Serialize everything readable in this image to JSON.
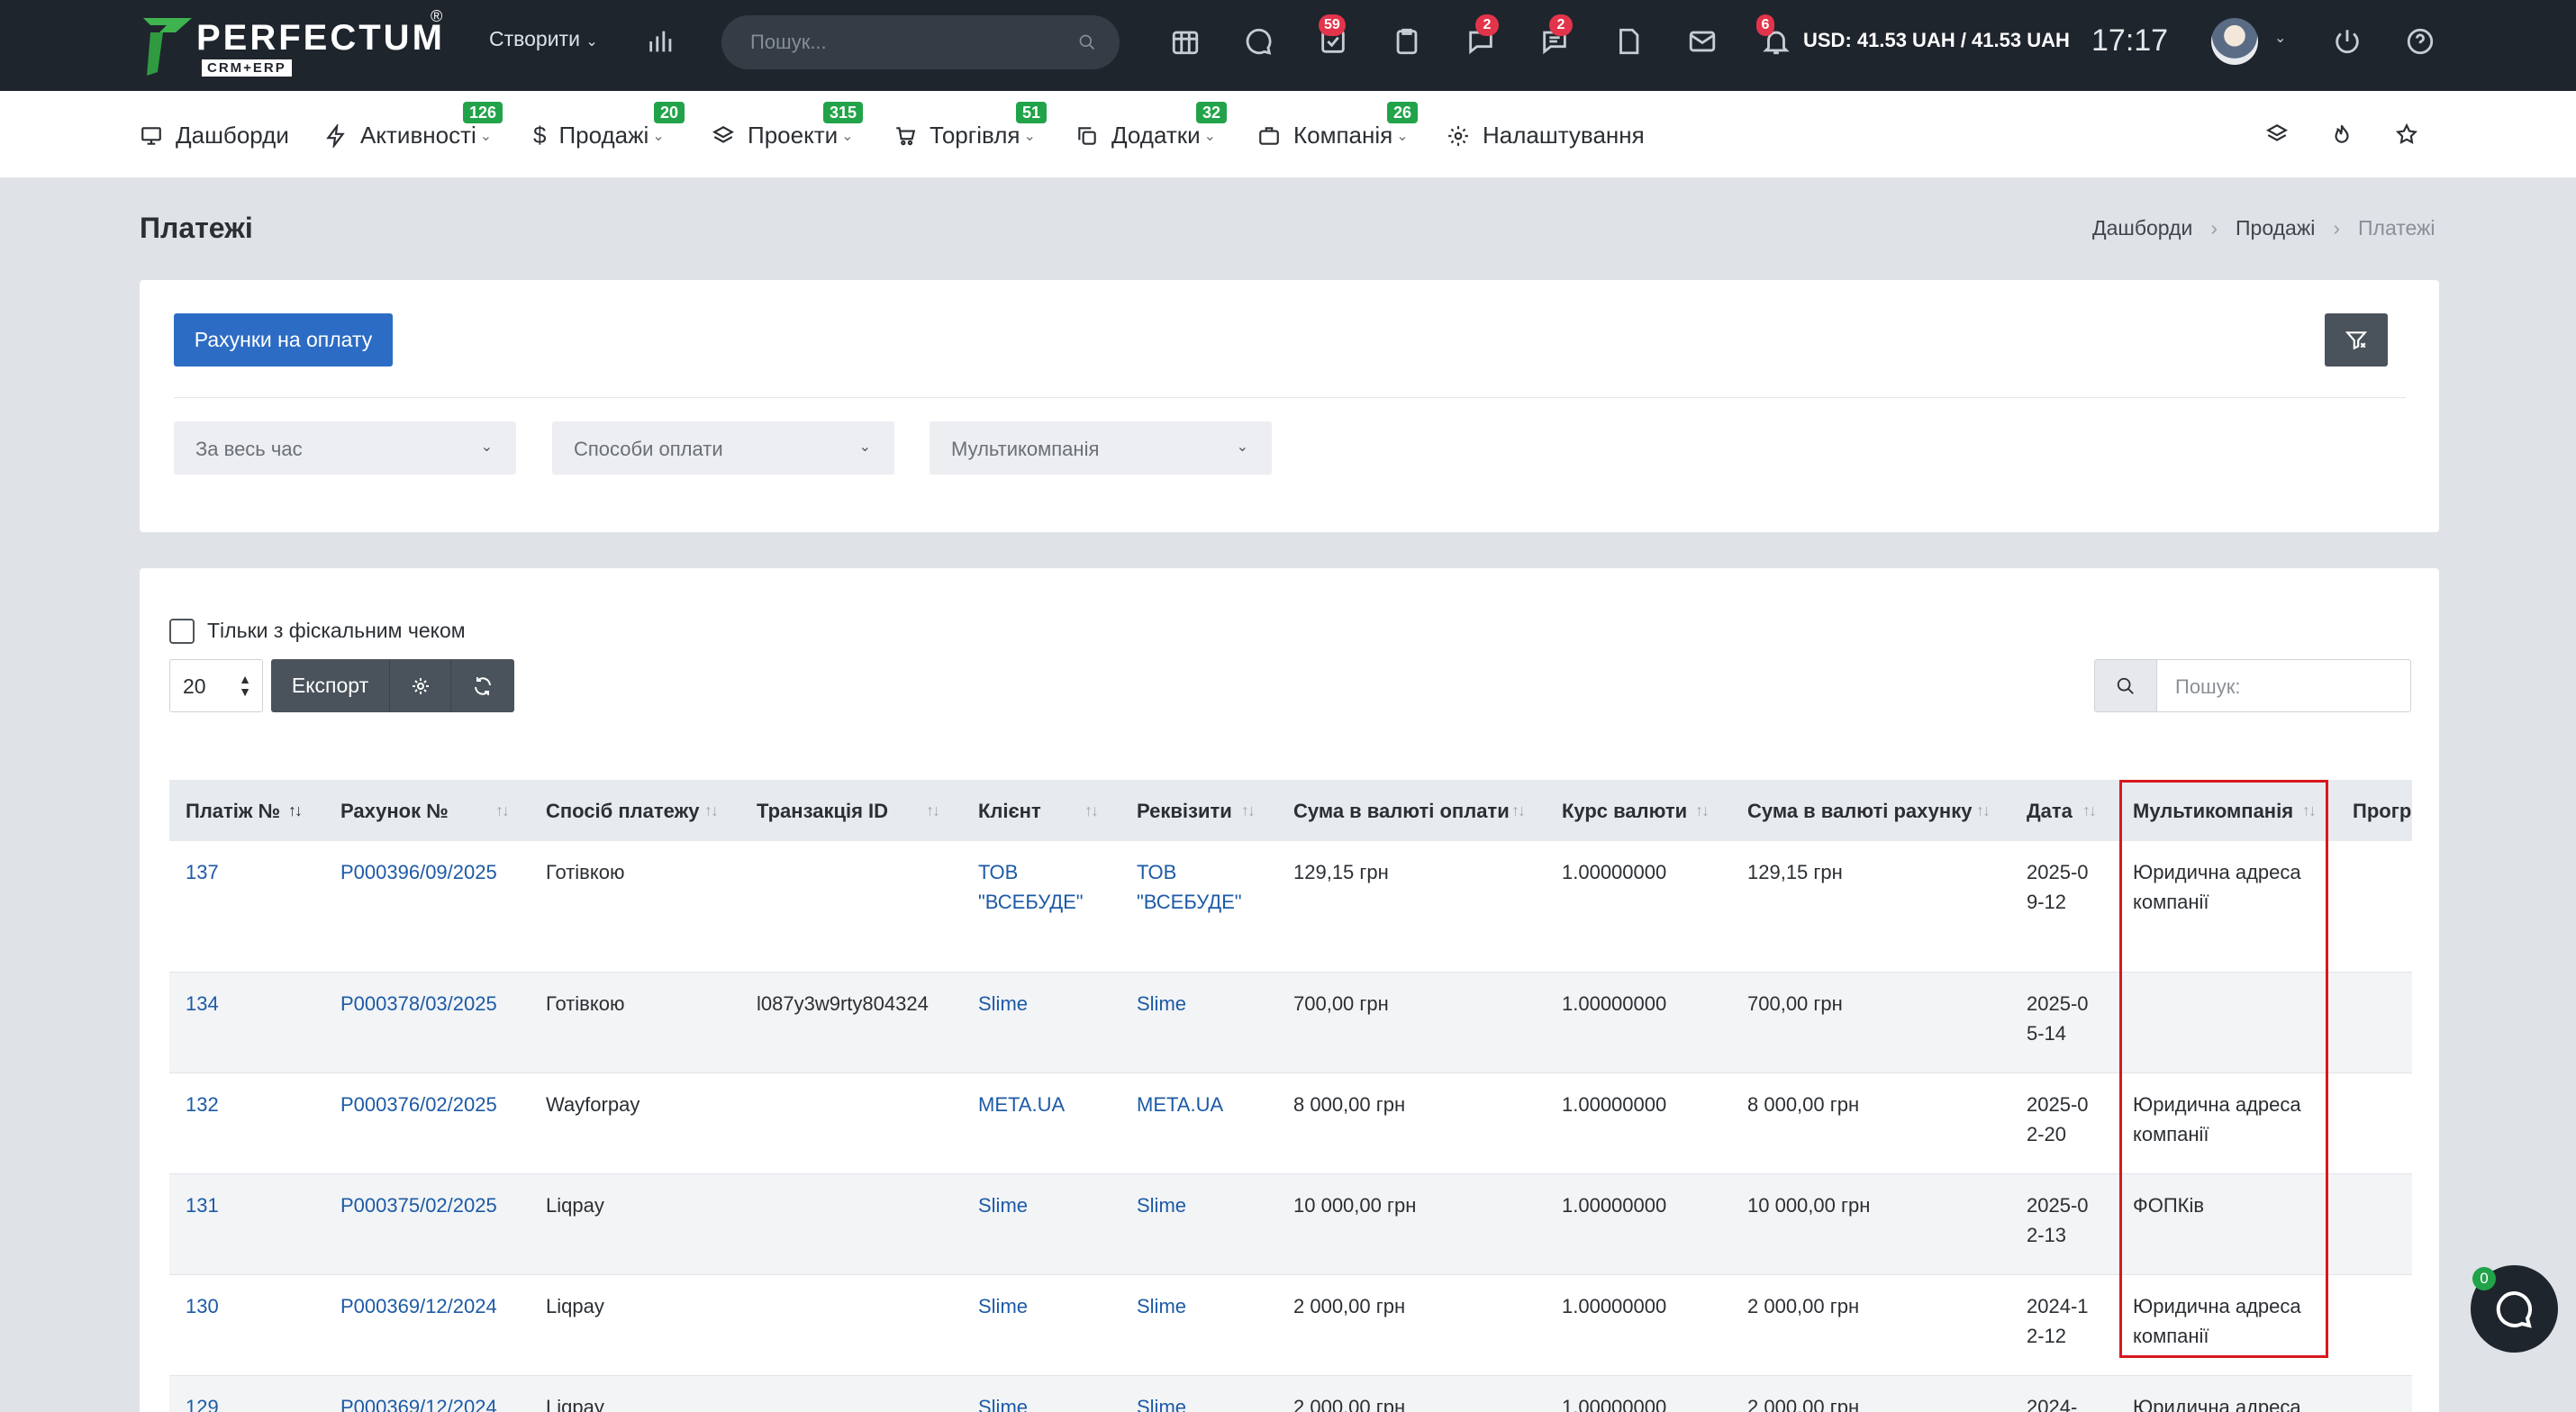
{
  "topbar": {
    "logo_text": "PERFECTUM",
    "logo_sub": "CRM+ERP",
    "logo_reg": "®",
    "create_label": "Створити",
    "search_placeholder": "Пошук...",
    "badges": {
      "tasks": "59",
      "chat": "2",
      "messages": "2",
      "notifications": "6"
    },
    "currency": "USD: 41.53 UAH / 41.53 UAH",
    "clock": "17:17"
  },
  "menu": {
    "items": [
      {
        "label": "Дашборди",
        "icon": "monitor-icon"
      },
      {
        "label": "Активності",
        "badge": "126",
        "icon": "bolt-icon"
      },
      {
        "label": "Продажі",
        "badge": "20",
        "icon": "dollar-icon"
      },
      {
        "label": "Проекти",
        "badge": "315",
        "icon": "layers-icon"
      },
      {
        "label": "Торгівля",
        "badge": "51",
        "icon": "cart-icon"
      },
      {
        "label": "Додатки",
        "badge": "32",
        "icon": "copy-icon"
      },
      {
        "label": "Компанія",
        "badge": "26",
        "icon": "briefcase-icon"
      },
      {
        "label": "Налаштування",
        "icon": "gear-icon"
      }
    ]
  },
  "page": {
    "title": "Платежі",
    "breadcrumb": [
      "Дашборди",
      "Продажі",
      "Платежі"
    ]
  },
  "filters": {
    "invoices_button": "Рахунки на оплату",
    "period": "За весь час",
    "payment_methods": "Способи оплати",
    "multicompany": "Мультикомпанія"
  },
  "table_controls": {
    "fiscal_only_label": "Тільки з фіскальним чеком",
    "page_size": "20",
    "export_label": "Експорт",
    "search_placeholder": "Пошук:"
  },
  "table": {
    "columns": [
      "Платіж №",
      "Рахунок №",
      "Спосіб платежу",
      "Транзакція ID",
      "Клієнт",
      "Реквізити",
      "Сума в валюті оплати",
      "Курс валюти",
      "Сума в валюті рахунку",
      "Дата",
      "Мультикомпанія",
      "Прогр"
    ],
    "rows": [
      {
        "id": "137",
        "invoice": "P000396/09/2025",
        "method": "Готівкою",
        "txn": "",
        "client": "ТОВ \"ВСЕБУДЕ\"",
        "requisites": "ТОВ \"ВСЕБУДЕ\"",
        "sum_pay": "129,15 грн",
        "rate": "1.00000000",
        "sum_inv": "129,15 грн",
        "date": "2025-09-12",
        "multi": "Юридична адреса компанії"
      },
      {
        "id": "134",
        "invoice": "P000378/03/2025",
        "method": "Готівкою",
        "txn": "l087y3w9rty804324",
        "client": "Slime",
        "requisites": "Slime",
        "sum_pay": "700,00 грн",
        "rate": "1.00000000",
        "sum_inv": "700,00 грн",
        "date": "2025-05-14",
        "multi": ""
      },
      {
        "id": "132",
        "invoice": "P000376/02/2025",
        "method": "Wayforpay",
        "txn": "",
        "client": "META.UA",
        "requisites": "META.UA",
        "sum_pay": "8 000,00 грн",
        "rate": "1.00000000",
        "sum_inv": "8 000,00 грн",
        "date": "2025-02-20",
        "multi": "Юридична адреса компанії"
      },
      {
        "id": "131",
        "invoice": "P000375/02/2025",
        "method": "Liqpay",
        "txn": "",
        "client": "Slime",
        "requisites": "Slime",
        "sum_pay": "10 000,00 грн",
        "rate": "1.00000000",
        "sum_inv": "10 000,00 грн",
        "date": "2025-02-13",
        "multi": "ФОПКів"
      },
      {
        "id": "130",
        "invoice": "P000369/12/2024",
        "method": "Liqpay",
        "txn": "",
        "client": "Slime",
        "requisites": "Slime",
        "sum_pay": "2 000,00 грн",
        "rate": "1.00000000",
        "sum_inv": "2 000,00 грн",
        "date": "2024-12-12",
        "multi": "Юридична адреса компанії"
      },
      {
        "id": "129",
        "invoice": "P000369/12/2024",
        "method": "Liqpay",
        "txn": "",
        "client": "Slime",
        "requisites": "Slime",
        "sum_pay": "2 000,00 грн",
        "rate": "1.00000000",
        "sum_inv": "2 000,00 грн",
        "date": "2024-",
        "multi": "Юридична адреса"
      }
    ]
  },
  "chat": {
    "badge": "0"
  },
  "colors": {
    "topbar": "#1f252d",
    "primary": "#2d6cc4",
    "link": "#1d5aa6",
    "badge_red": "#e2344a",
    "badge_green": "#22a34a",
    "highlight": "#d8181f"
  }
}
